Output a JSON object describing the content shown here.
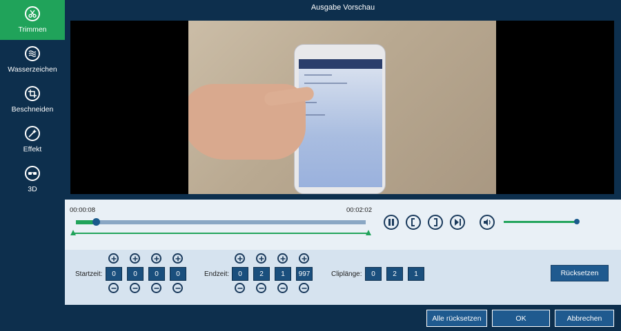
{
  "window": {
    "title": "Ausgabe Vorschau"
  },
  "sidebar": {
    "items": [
      {
        "label": "Trimmen",
        "icon": "scissors-icon",
        "active": true
      },
      {
        "label": "Wasserzeichen",
        "icon": "waves-icon",
        "active": false
      },
      {
        "label": "Beschneiden",
        "icon": "crop-icon",
        "active": false
      },
      {
        "label": "Effekt",
        "icon": "magic-icon",
        "active": false
      },
      {
        "label": "3D",
        "icon": "glasses-icon",
        "active": false
      }
    ]
  },
  "player": {
    "start_time": "00:00:08",
    "end_time": "00:02:02",
    "progress_fraction": 0.07,
    "volume_fraction": 1.0,
    "controls": [
      "pause-icon",
      "set-start-icon",
      "set-end-icon",
      "next-frame-icon",
      "volume-icon"
    ]
  },
  "trim": {
    "start_label": "Startzeit:",
    "start_values": [
      "0",
      "0",
      "0",
      "0"
    ],
    "end_label": "Endzeit:",
    "end_values": [
      "0",
      "2",
      "1",
      "997"
    ],
    "length_label": "Cliplänge:",
    "length_values": [
      "0",
      "2",
      "1"
    ],
    "reset_label": "Rücksetzen"
  },
  "footer": {
    "reset_all_label": "Alle rücksetzen",
    "ok_label": "OK",
    "cancel_label": "Abbrechen"
  },
  "colors": {
    "sidebar_bg": "#0d2f4d",
    "accent_green": "#20a35a",
    "button_blue": "#1f5a8f"
  }
}
